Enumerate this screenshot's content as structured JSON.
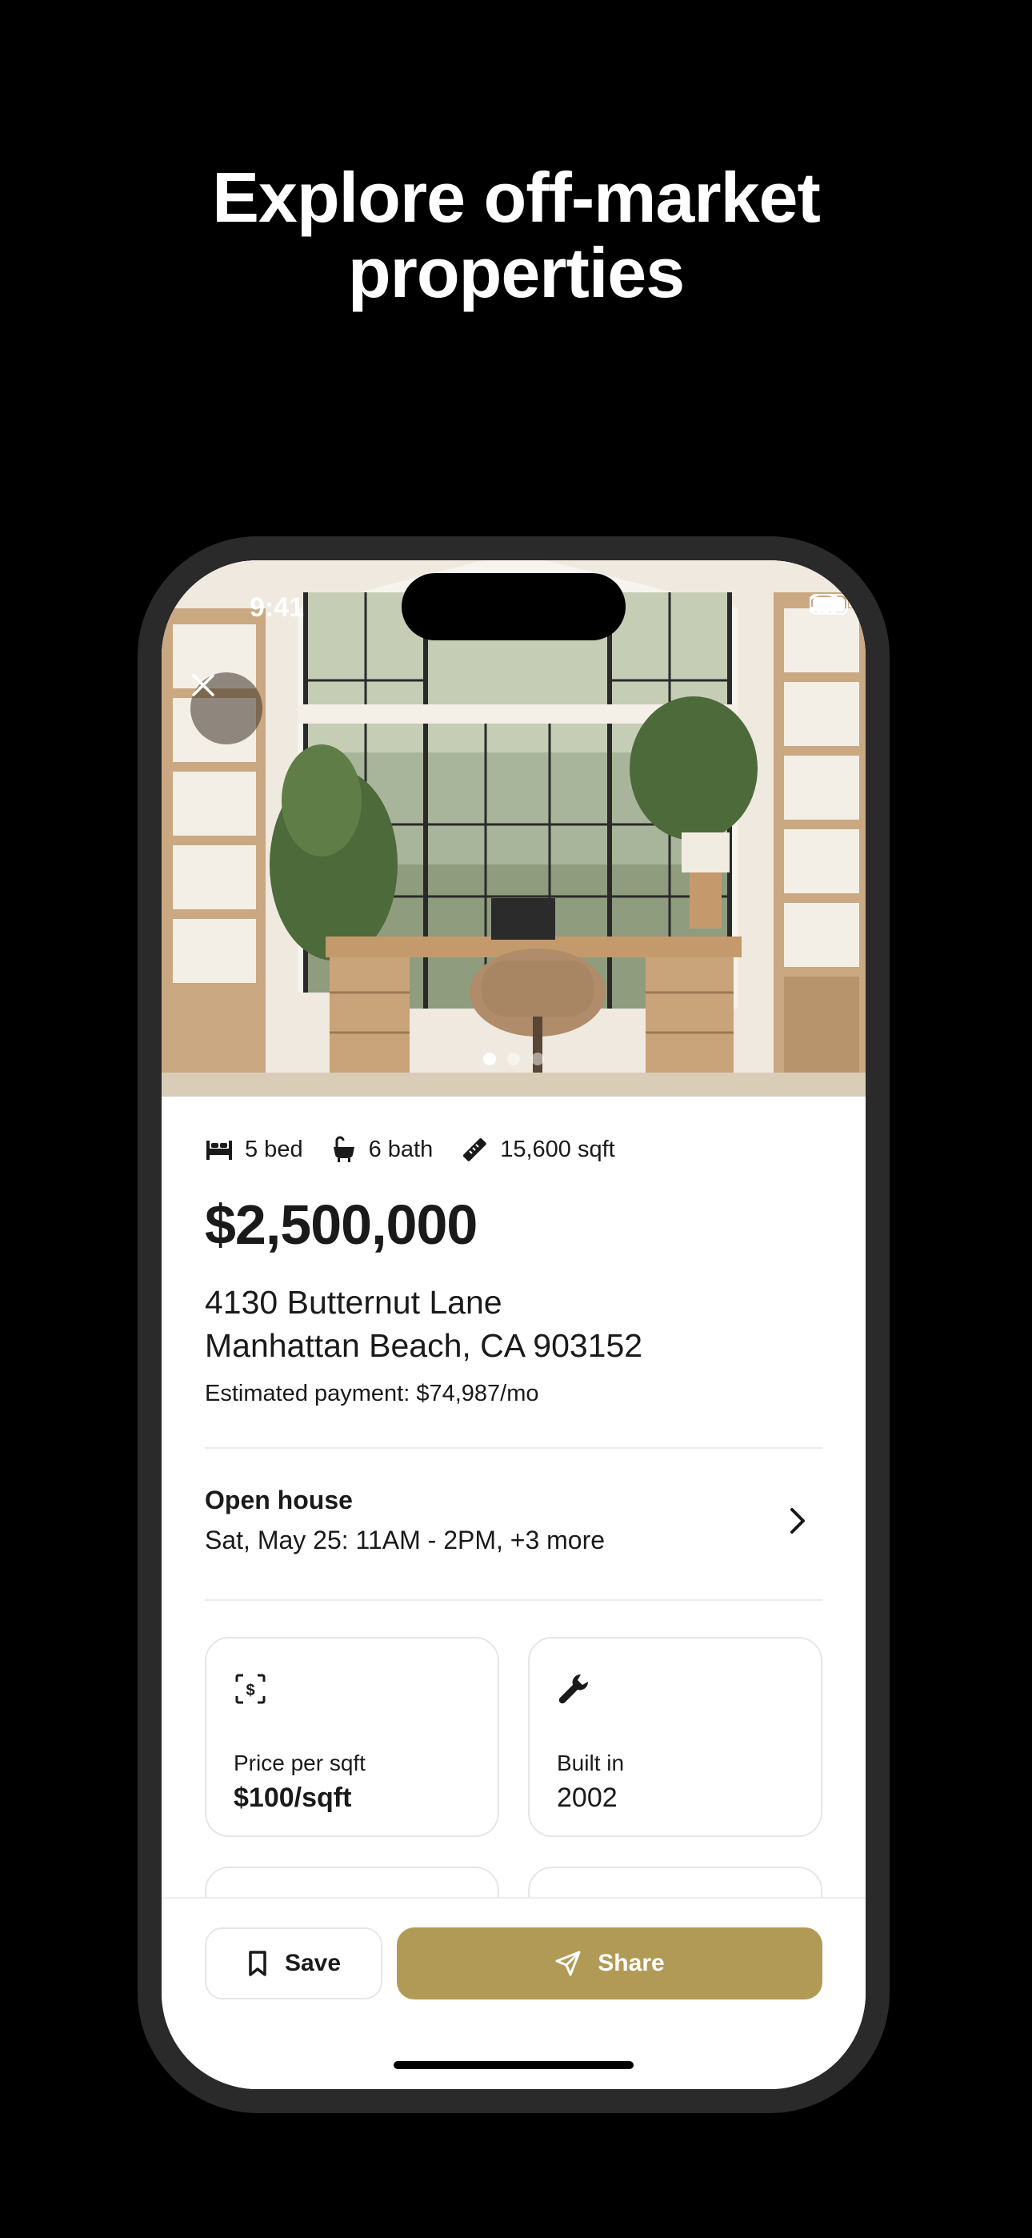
{
  "headline": {
    "line1": "Explore off-market",
    "line2": "properties"
  },
  "status_bar": {
    "time": "9:41"
  },
  "gallery": {
    "photo_count": 3,
    "active_index": 0
  },
  "listing": {
    "beds": "5 bed",
    "baths": "6 bath",
    "area": "15,600 sqft",
    "price": "$2,500,000",
    "address_line1": "4130 Butternut Lane",
    "address_line2": "Manhattan Beach, CA 903152",
    "estimated_payment": "Estimated payment: $74,987/mo"
  },
  "open_house": {
    "title": "Open house",
    "schedule": "Sat, May 25: 11AM - 2PM, +3 more"
  },
  "cards": [
    {
      "icon": "dollar-scan-icon",
      "label": "Price per sqft",
      "value": "$100/sqft"
    },
    {
      "icon": "wrench-icon",
      "label": "Built in",
      "value": "2002"
    }
  ],
  "actions": {
    "save_label": "Save",
    "share_label": "Share"
  },
  "colors": {
    "accent": "#b19a55",
    "background": "#000000"
  }
}
